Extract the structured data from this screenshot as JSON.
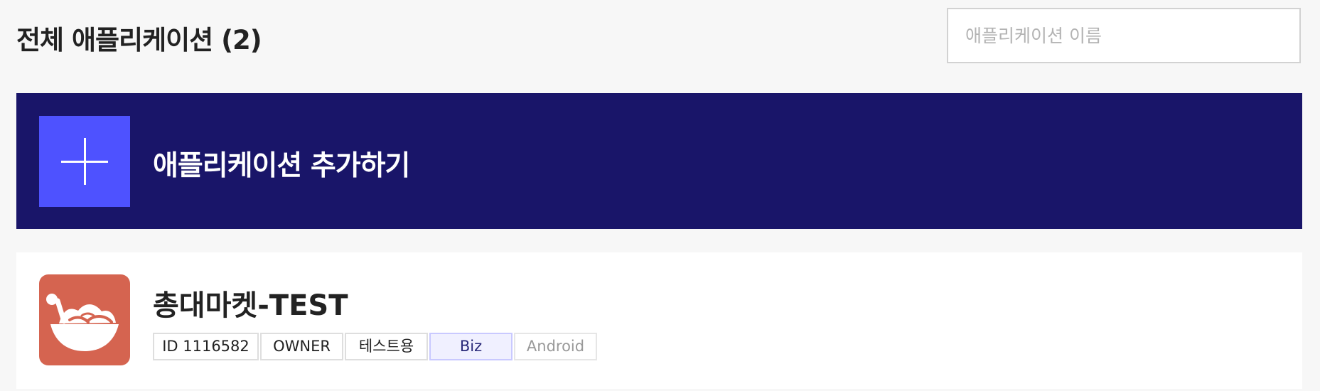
{
  "header": {
    "title": "전체 애플리케이션 (2)",
    "search": {
      "placeholder": "애플리케이션 이름",
      "value": ""
    }
  },
  "add_application": {
    "label": "애플리케이션 추가하기",
    "icon": "plus-icon"
  },
  "applications": [
    {
      "name": "총대마켓-TEST",
      "icon": "basket-food-icon",
      "badges": {
        "id": "ID 1116582",
        "role": "OWNER",
        "purpose": "테스트용",
        "type": "Biz",
        "platform": "Android"
      }
    }
  ],
  "colors": {
    "page_background": "#f7f7f7",
    "banner_background": "#191569",
    "add_button_background": "#4e52ff",
    "app_icon_background": "#d56450"
  }
}
